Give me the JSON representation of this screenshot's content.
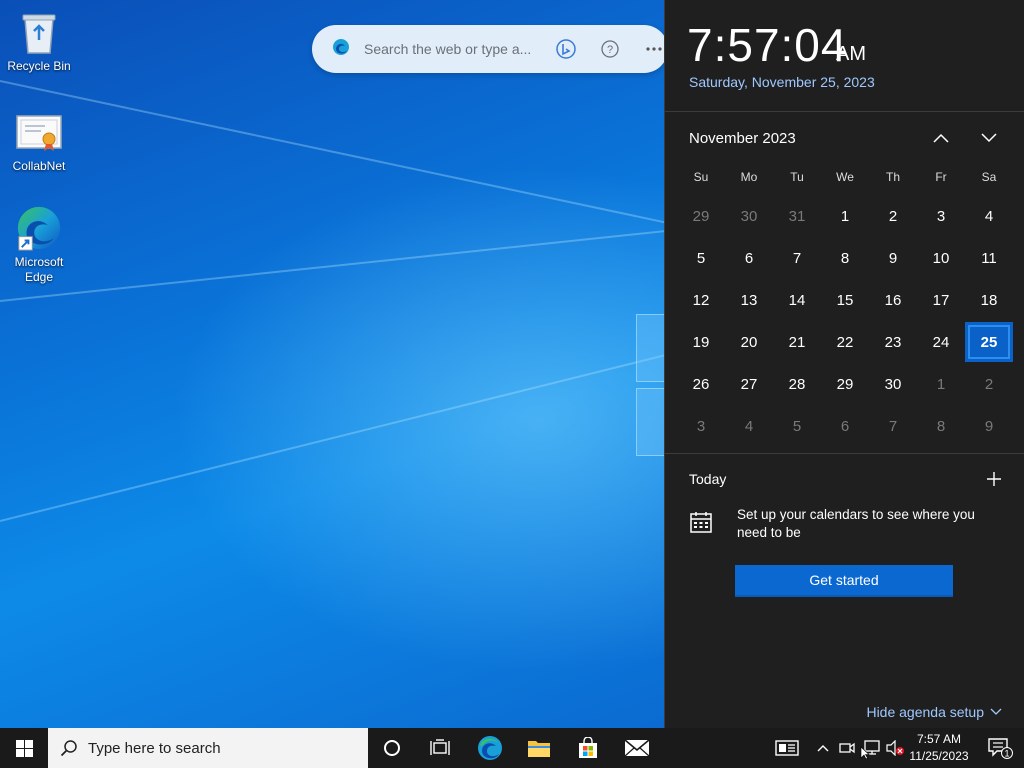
{
  "desktop": {
    "icons": [
      {
        "label": "Recycle Bin",
        "icon": "recycle-bin-icon"
      },
      {
        "label": "CollabNet",
        "icon": "certificate-icon"
      },
      {
        "label": "Microsoft\nEdge",
        "icon": "edge-icon"
      }
    ]
  },
  "edge_bar": {
    "placeholder": "Search the web or type a..."
  },
  "flyout": {
    "time": "7:57:04",
    "ampm": "AM",
    "long_date": "Saturday, November 25, 2023",
    "month_label": "November 2023",
    "weekdays": [
      "Su",
      "Mo",
      "Tu",
      "We",
      "Th",
      "Fr",
      "Sa"
    ],
    "days": [
      [
        "29",
        "30",
        "31",
        "1",
        "2",
        "3",
        "4"
      ],
      [
        "5",
        "6",
        "7",
        "8",
        "9",
        "10",
        "11"
      ],
      [
        "12",
        "13",
        "14",
        "15",
        "16",
        "17",
        "18"
      ],
      [
        "19",
        "20",
        "21",
        "22",
        "23",
        "24",
        "25"
      ],
      [
        "26",
        "27",
        "28",
        "29",
        "30",
        "1",
        "2"
      ],
      [
        "3",
        "4",
        "5",
        "6",
        "7",
        "8",
        "9"
      ]
    ],
    "today_heading": "Today",
    "setup_text": "Set up your calendars to see where you need to be",
    "get_started": "Get started",
    "hide_agenda": "Hide agenda setup"
  },
  "taskbar": {
    "search_placeholder": "Type here to search",
    "tray_time": "7:57 AM",
    "tray_date": "11/25/2023",
    "notification_count": "1"
  },
  "colors": {
    "accent": "#0a68d0",
    "today_highlight": "#0a62c9",
    "flyout_bg": "#1f1f1f",
    "taskbar_bg": "#1a1a1a"
  }
}
